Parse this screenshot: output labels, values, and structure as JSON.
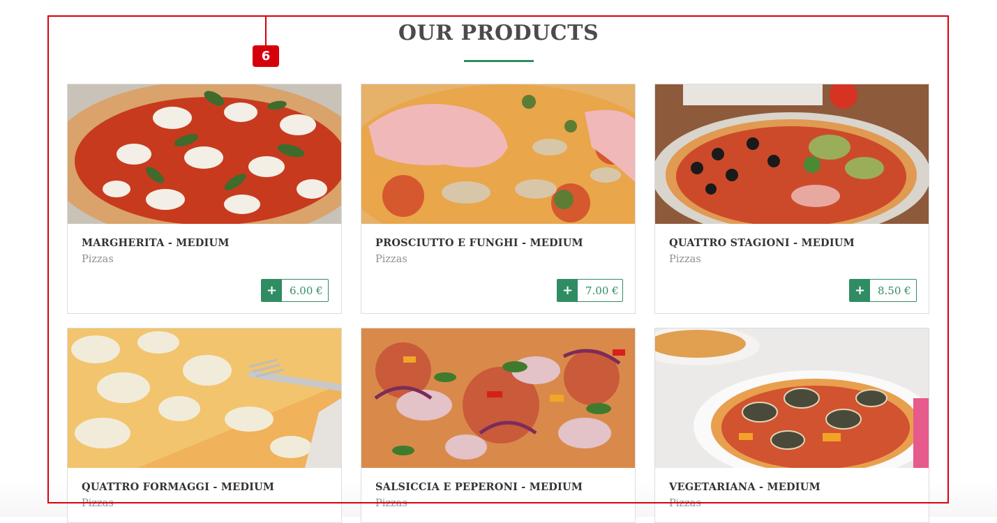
{
  "section": {
    "title": "OUR PRODUCTS"
  },
  "annotation": {
    "badge": "6"
  },
  "currency": "€",
  "products": [
    {
      "name": "MARGHERITA - MEDIUM",
      "category": "Pizzas",
      "price": "6.00 €",
      "add_symbol": "+"
    },
    {
      "name": "PROSCIUTTO E FUNGHI - MEDIUM",
      "category": "Pizzas",
      "price": "7.00 €",
      "add_symbol": "+"
    },
    {
      "name": "QUATTRO STAGIONI - MEDIUM",
      "category": "Pizzas",
      "price": "8.50 €",
      "add_symbol": "+"
    },
    {
      "name": "QUATTRO FORMAGGI - MEDIUM",
      "category": "Pizzas"
    },
    {
      "name": "SALSICCIA E PEPERONI - MEDIUM",
      "category": "Pizzas"
    },
    {
      "name": "VEGETARIANA - MEDIUM",
      "category": "Pizzas"
    }
  ],
  "colors": {
    "accent": "#2f8c63",
    "highlight": "#d6000d",
    "title": "#4b4b4b"
  }
}
